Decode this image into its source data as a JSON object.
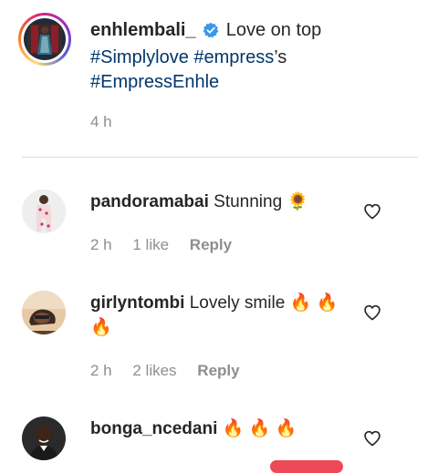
{
  "post": {
    "username": "enhlembali_",
    "caption_text": "Love on top",
    "hashtags": [
      "#Simplylove",
      "#empress",
      "#EmpressEnhle"
    ],
    "possessive_suffix": "’s",
    "time": "4 h"
  },
  "comments": [
    {
      "username": "pandoramabai",
      "text": "Stunning 🌻",
      "time": "2 h",
      "likes": "1 like",
      "reply_label": "Reply"
    },
    {
      "username": "girlyntombi",
      "text": "Lovely smile 🔥 🔥 🔥",
      "time": "2 h",
      "likes": "2 likes",
      "reply_label": "Reply"
    },
    {
      "username": "bonga_ncedani",
      "text": "🔥 🔥 🔥"
    }
  ],
  "colors": {
    "hashtag": "#00376b",
    "verified": "#3897f0",
    "meta": "#8e8e8e",
    "accent": "#ed4956"
  },
  "icons": [
    "verified-badge-icon",
    "heart-icon"
  ]
}
